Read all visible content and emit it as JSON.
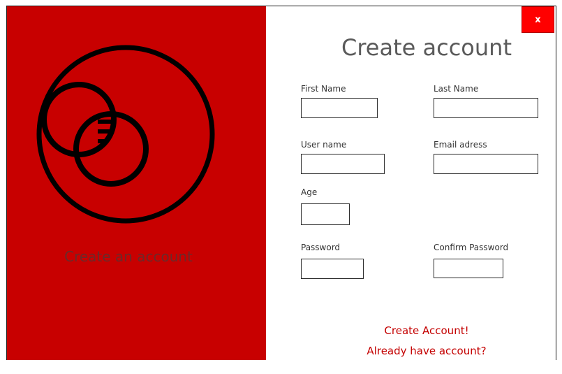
{
  "left_panel": {
    "caption": "Create an account"
  },
  "close_button": {
    "label": "x"
  },
  "form": {
    "title": "Create account",
    "fields": {
      "first_name": {
        "label": "First Name",
        "value": ""
      },
      "last_name": {
        "label": "Last Name",
        "value": ""
      },
      "user_name": {
        "label": "User name",
        "value": ""
      },
      "email": {
        "label": "Email adress",
        "value": ""
      },
      "age": {
        "label": "Age",
        "value": ""
      },
      "password": {
        "label": "Password",
        "value": ""
      },
      "confirm_password": {
        "label": "Confirm Password",
        "value": ""
      }
    },
    "create_link": "Create Account!",
    "login_link": "Already have account?"
  },
  "colors": {
    "panel": "#c80000",
    "close_button": "#ff0000",
    "link": "#c40000",
    "title": "#5a5a5a"
  }
}
